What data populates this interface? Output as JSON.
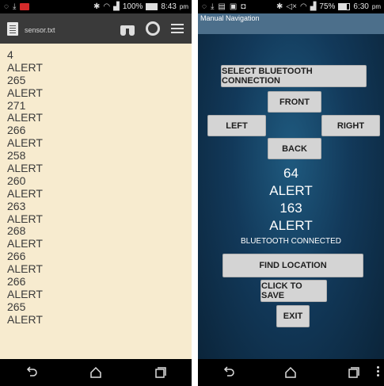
{
  "left_phone": {
    "status": {
      "battery": "100%",
      "time": "8:43",
      "ampm": "pm"
    },
    "file_name": "sensor.txt",
    "lines": [
      "4",
      "ALERT",
      "265",
      "ALERT",
      "271",
      "ALERT",
      "266",
      "ALERT",
      "258",
      "ALERT",
      "260",
      "ALERT",
      "263",
      "ALERT",
      "268",
      "ALERT",
      "266",
      "ALERT",
      "266",
      "ALERT",
      "265",
      "ALERT"
    ]
  },
  "right_phone": {
    "status": {
      "battery": "75%",
      "time": "6:30",
      "ampm": "pm"
    },
    "title": "Manual Navigation",
    "buttons": {
      "select": "SELECT BLUETOOTH CONNECTION",
      "front": "FRONT",
      "left": "LEFT",
      "right": "RIGHT",
      "back": "BACK",
      "find": "FIND LOCATION",
      "save": "CLICK TO SAVE",
      "exit": "EXIT"
    },
    "readings": [
      "64",
      "ALERT",
      "163",
      "ALERT"
    ],
    "connection_status": "BLUETOOTH CONNECTED"
  },
  "colors": {
    "notepad_bg": "#f7ebcf",
    "appbar": "#3a3a3a",
    "app_title_bar": "#4c6f8b",
    "button": "#d4d4d4",
    "blue_background": "#12395a"
  },
  "icons": {
    "left_status": [
      "whatsapp-icon",
      "download-icon",
      "notification-red-icon"
    ],
    "right_status": [
      "whatsapp-icon",
      "download-icon",
      "gallery-icon",
      "chat-icon",
      "camera-icon"
    ],
    "appbar": [
      "document-icon",
      "binoculars-icon",
      "gear-icon",
      "menu-icon"
    ],
    "navigation": [
      "back-icon",
      "home-icon",
      "recent-apps-icon",
      "more-icon"
    ]
  }
}
